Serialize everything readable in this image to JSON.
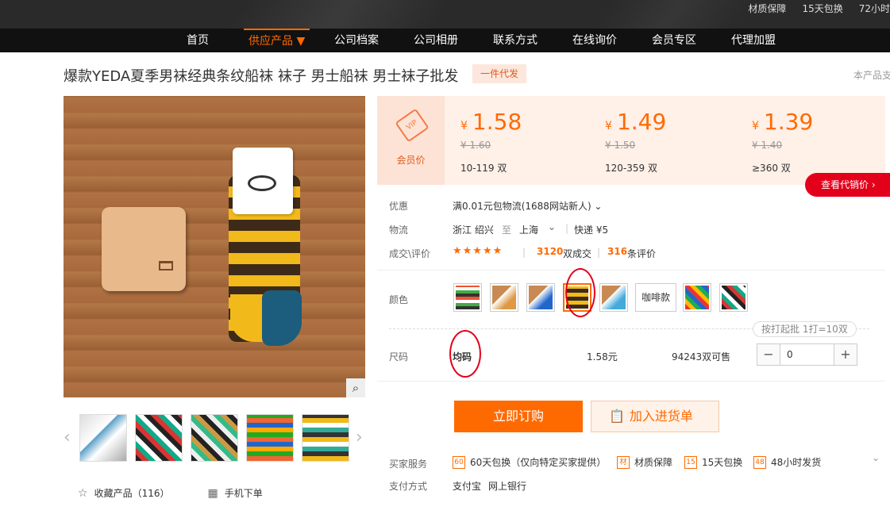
{
  "topbar": {
    "guarantees": [
      "材质保障",
      "15天包换",
      "72小时"
    ]
  },
  "nav": {
    "items": [
      "首页",
      "供应产品 ▼",
      "公司档案",
      "公司相册",
      "联系方式",
      "在线询价",
      "会员专区",
      "代理加盟"
    ]
  },
  "product": {
    "title": "爆款YEDA夏季男袜经典条纹船袜 袜子 男士船袜 男士袜子批发",
    "badge": "一件代发",
    "support_text": "本产品支",
    "main_image": "striped-yellow-brown-boat-sock-on-wood-table",
    "zoom_icon": "magnifier-icon",
    "thumbnails": [
      "sock-thumb-1",
      "sock-thumb-2",
      "sock-thumb-3",
      "sock-thumb-4",
      "sock-thumb-5"
    ]
  },
  "bottom": {
    "favorite": "收藏产品（116）",
    "mobile": "手机下单"
  },
  "pricing": {
    "vip_label": "会员价",
    "vip_tag": "VIP",
    "currency": "¥",
    "tiers": [
      {
        "price": "1.58",
        "old_price": "¥ 1.60",
        "range": "10-119 双"
      },
      {
        "price": "1.49",
        "old_price": "¥ 1.50",
        "range": "120-359 双"
      },
      {
        "price": "1.39",
        "old_price": "¥ 1.40",
        "range": "≥360 双"
      }
    ],
    "agent_button": "查看代销价 ›"
  },
  "details": {
    "discount_label": "优惠",
    "discount_value": "满0.01元包物流(1688网站新人) ⌄",
    "logistics_label": "物流",
    "logistics_from": "浙江 绍兴",
    "logistics_to_word": "至",
    "logistics_to": "上海",
    "logistics_express": "快递 ¥5",
    "deals_label": "成交\\评价",
    "stars": "★★★★★",
    "deal_count": "3120",
    "deal_unit": "双成交",
    "review_count": "316",
    "review_unit": "条评价"
  },
  "color": {
    "label": "颜色",
    "text_option": "咖啡款",
    "batch_note": "按打起批 1打=10双"
  },
  "size": {
    "label": "尺码",
    "value": "均码",
    "price": "1.58元",
    "stock": "94243双可售",
    "quantity": "0",
    "minus": "−",
    "plus": "+"
  },
  "actions": {
    "order": "立即订购",
    "cart": "加入进货单"
  },
  "services": {
    "label": "买家服务",
    "items": [
      {
        "icon": "60",
        "text": "60天包换（仅向特定买家提供）"
      },
      {
        "icon": "材",
        "text": "材质保障"
      },
      {
        "icon": "15",
        "text": "15天包换"
      },
      {
        "icon": "48",
        "text": "48小时发货"
      }
    ]
  },
  "payment": {
    "label": "支付方式",
    "methods": [
      "支付宝",
      "网上银行"
    ]
  },
  "colors": {
    "accent": "#ff6a00",
    "agent_red": "#e3001b",
    "price_bg": "#fff0e8"
  }
}
